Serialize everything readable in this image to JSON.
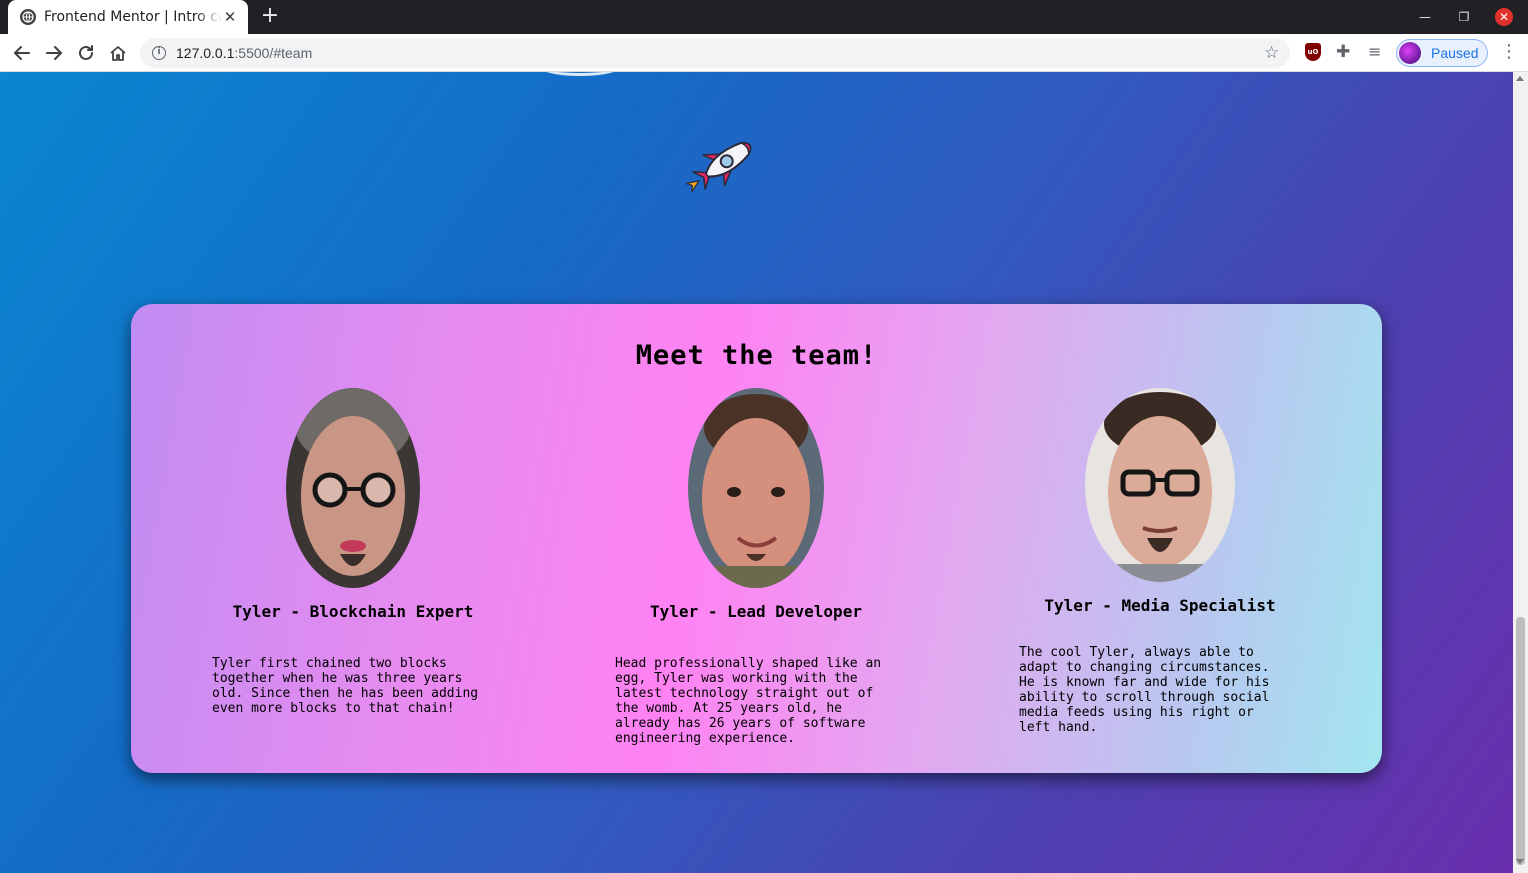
{
  "browser": {
    "tab_title": "Frontend Mentor | Intro component",
    "url_host": "127.0.0.1",
    "url_rest": ":5500/#team",
    "profile_label": "Paused",
    "new_tab_glyph": "+",
    "close_glyph": "✕"
  },
  "page": {
    "team_title": "Meet the team!",
    "members": [
      {
        "name": "Tyler - Blockchain Expert",
        "bio": "Tyler first chained two blocks together when he was three years old. Since then he has been adding even more blocks to that chain!"
      },
      {
        "name": "Tyler - Lead Developer",
        "bio": "Head professionally shaped like an egg, Tyler was working with the latest technology straight out of the womb. At 25 years old, he already has 26 years of software engineering experience."
      },
      {
        "name": "Tyler - Media Specialist",
        "bio": "The cool Tyler, always able to adapt to changing circumstances. He is known far and wide for his ability to scroll through social media feeds using his right or left hand."
      }
    ]
  },
  "colors": {
    "chrome_dark": "#202124",
    "page_gradient_start": "#0a87d0",
    "page_gradient_end": "#6a2fae",
    "card_pink": "#ff82f3",
    "card_cyan": "#a2e6ef"
  },
  "icons": [
    "globe-icon",
    "back-arrow-icon",
    "forward-arrow-icon",
    "reload-icon",
    "home-icon",
    "info-icon",
    "star-icon",
    "ublock-icon",
    "puzzle-icon",
    "media-icon",
    "kebab-menu-icon",
    "rocket-icon"
  ]
}
